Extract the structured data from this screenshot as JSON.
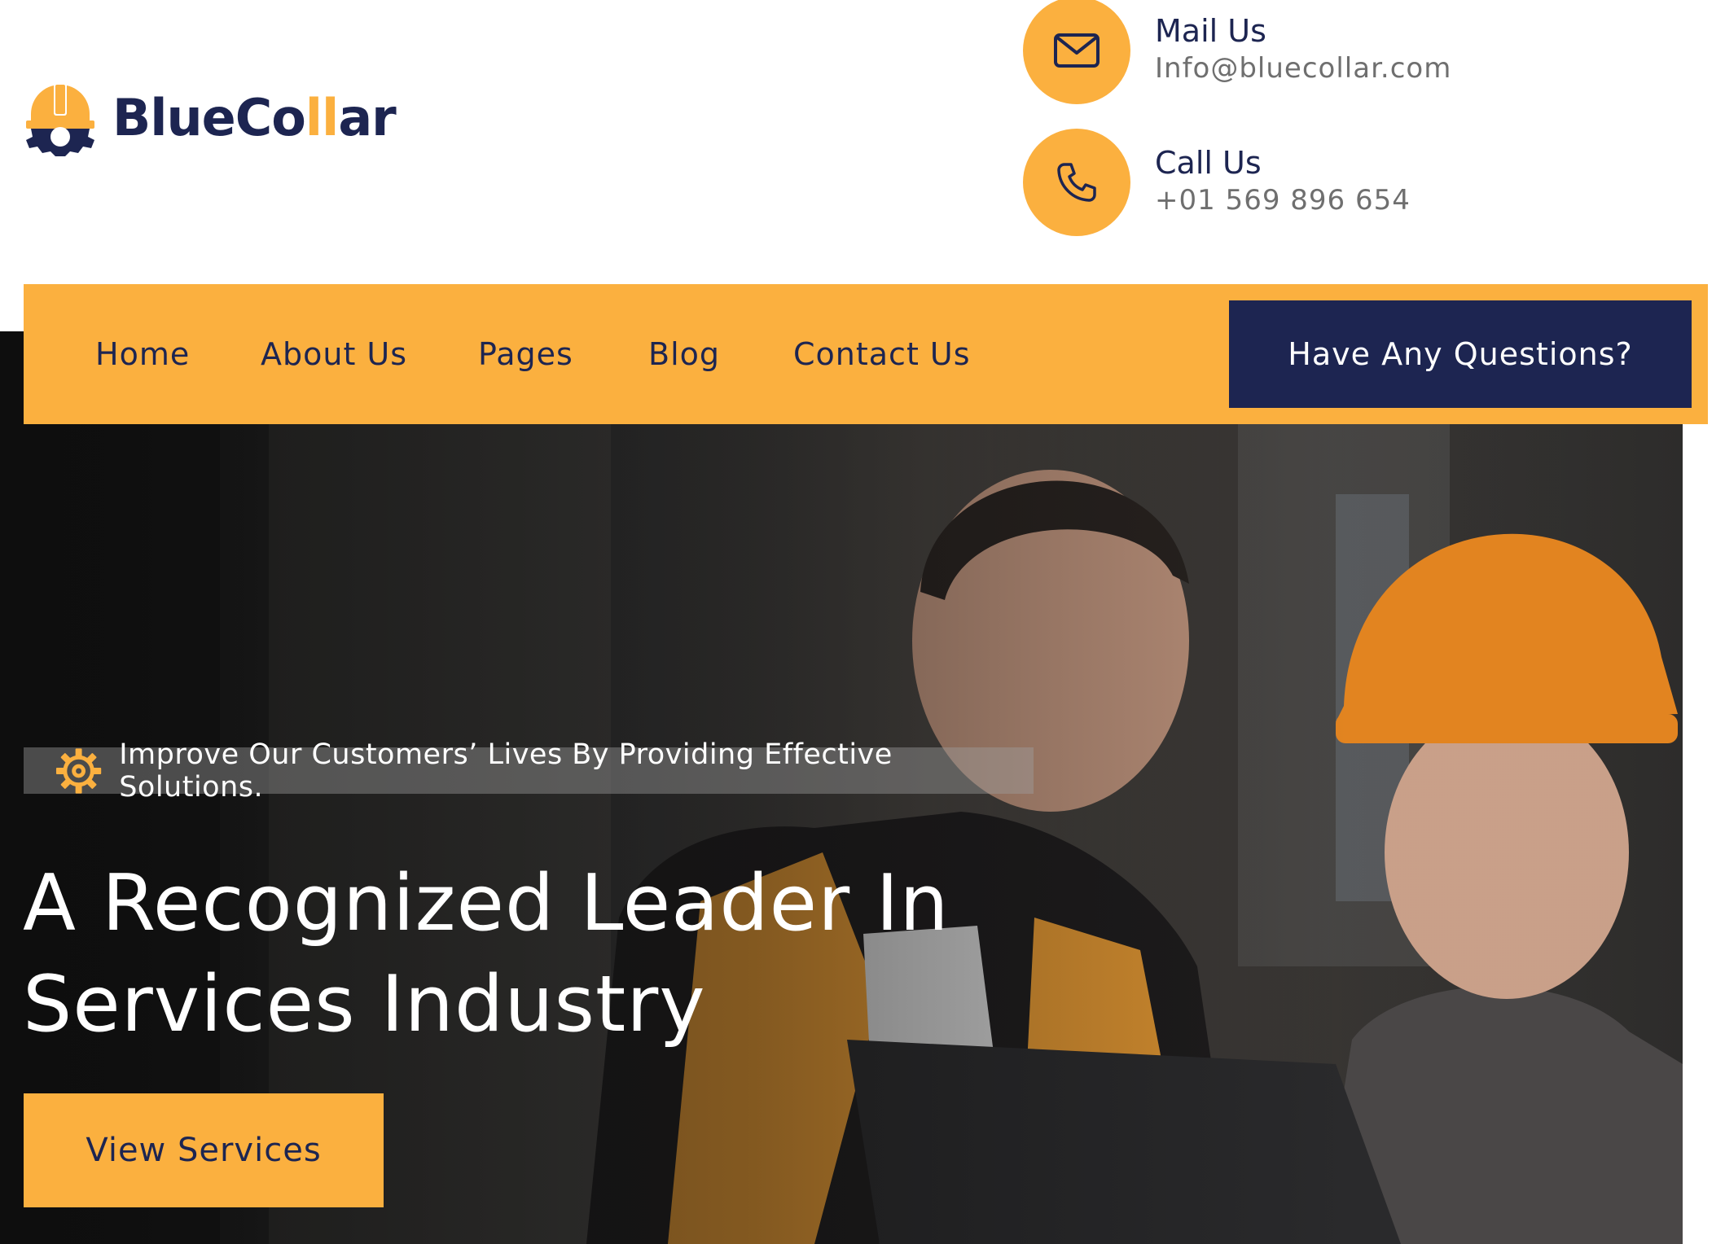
{
  "brand": {
    "name_start": "BlueCo",
    "name_accent": "ll",
    "name_end": "ar"
  },
  "contacts": {
    "mail": {
      "icon": "mail-icon",
      "title": "Mail Us",
      "value": "Info@bluecollar.com"
    },
    "call": {
      "icon": "phone-icon",
      "title": "Call Us",
      "value": "+01 569 896 654"
    }
  },
  "nav": {
    "items": [
      "Home",
      "About Us",
      "Pages",
      "Blog",
      "Contact Us"
    ],
    "cta": "Have Any Questions?"
  },
  "hero": {
    "tagline": "Improve Our Customers’ Lives By Providing Effective Solutions.",
    "headline_line1": "A Recognized Leader In",
    "headline_line2": "Services Industry",
    "button": "View Services"
  },
  "colors": {
    "accent": "#fbb03f",
    "navy": "#1d2551",
    "muted_text": "#6f6f6f"
  }
}
